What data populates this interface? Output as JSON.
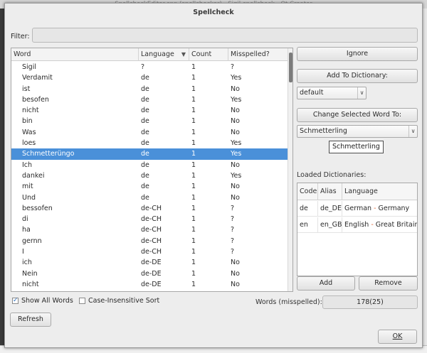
{
  "background": {
    "window_title": "SpellcheckEditor.cpp (spellchecker) - Sigil-spellcheck - Qt Creator"
  },
  "dialog": {
    "title": "Spellcheck",
    "filter_label": "Filter:",
    "filter_value": ""
  },
  "table": {
    "headers": {
      "word": "Word",
      "language": "Language",
      "count": "Count",
      "misspelled": "Misspelled?"
    },
    "sort_icon": "chevron-down-icon",
    "rows": [
      {
        "word": "Sigil",
        "language": "?",
        "count": "1",
        "misspelled": "?"
      },
      {
        "word": "Verdamit",
        "language": "de",
        "count": "1",
        "misspelled": "Yes"
      },
      {
        "word": "ist",
        "language": "de",
        "count": "1",
        "misspelled": "No"
      },
      {
        "word": "besofen",
        "language": "de",
        "count": "1",
        "misspelled": "Yes"
      },
      {
        "word": "nicht",
        "language": "de",
        "count": "1",
        "misspelled": "No"
      },
      {
        "word": "bin",
        "language": "de",
        "count": "1",
        "misspelled": "No"
      },
      {
        "word": "Was",
        "language": "de",
        "count": "1",
        "misspelled": "No"
      },
      {
        "word": "loes",
        "language": "de",
        "count": "1",
        "misspelled": "Yes"
      },
      {
        "word": "Schmetterüngo",
        "language": "de",
        "count": "1",
        "misspelled": "Yes",
        "selected": true
      },
      {
        "word": "Ich",
        "language": "de",
        "count": "1",
        "misspelled": "No"
      },
      {
        "word": "dankei",
        "language": "de",
        "count": "1",
        "misspelled": "Yes"
      },
      {
        "word": "mit",
        "language": "de",
        "count": "1",
        "misspelled": "No"
      },
      {
        "word": "Und",
        "language": "de",
        "count": "1",
        "misspelled": "No"
      },
      {
        "word": "bessofen",
        "language": "de-CH",
        "count": "1",
        "misspelled": "?"
      },
      {
        "word": "di",
        "language": "de-CH",
        "count": "1",
        "misspelled": "?"
      },
      {
        "word": "ha",
        "language": "de-CH",
        "count": "1",
        "misspelled": "?"
      },
      {
        "word": "gernn",
        "language": "de-CH",
        "count": "1",
        "misspelled": "?"
      },
      {
        "word": "I",
        "language": "de-CH",
        "count": "1",
        "misspelled": "?"
      },
      {
        "word": "ich",
        "language": "de-DE",
        "count": "1",
        "misspelled": "No"
      },
      {
        "word": "Nein",
        "language": "de-DE",
        "count": "1",
        "misspelled": "No"
      },
      {
        "word": "nicht",
        "language": "de-DE",
        "count": "1",
        "misspelled": "No"
      }
    ]
  },
  "actions": {
    "ignore": "Ignore",
    "add_to_dictionary": "Add To Dictionary:",
    "dictionary_selected": "default",
    "change_selected_word": "Change Selected Word To:",
    "replacement_value": "Schmetterling",
    "tooltip": "Schmetterling"
  },
  "dictionaries": {
    "label": "Loaded Dictionaries:",
    "headers": {
      "code": "Code",
      "alias": "Alias",
      "language": "Language"
    },
    "rows": [
      {
        "code": "de",
        "alias": "de_DE",
        "lang_a": "German",
        "sep": " - ",
        "lang_b": "Germany"
      },
      {
        "code": "en",
        "alias": "en_GB",
        "lang_a": "English",
        "sep": " - ",
        "lang_b": "Great Britain"
      }
    ],
    "add": "Add",
    "remove": "Remove"
  },
  "footer": {
    "show_all_words": "Show All Words",
    "show_all_checked": true,
    "case_insensitive": "Case-Insensitive Sort",
    "case_insensitive_checked": false,
    "words_label": "Words (misspelled):",
    "words_value": "178(25)",
    "refresh": "Refresh",
    "ok": "OK"
  },
  "colors": {
    "selection": "#4a90d9",
    "accent_separator": "#e0683a"
  }
}
